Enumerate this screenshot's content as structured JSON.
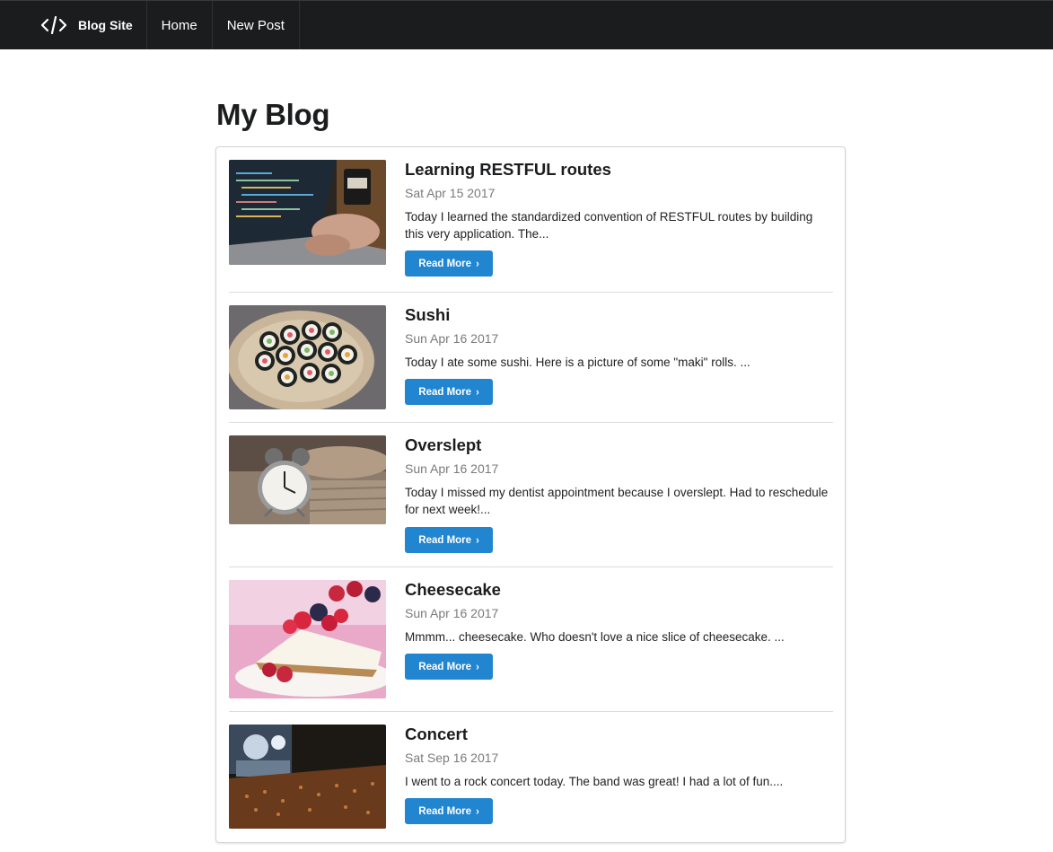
{
  "nav": {
    "brand_label": "Blog Site",
    "items": [
      {
        "label": "Home"
      },
      {
        "label": "New Post"
      }
    ]
  },
  "page": {
    "title": "My Blog"
  },
  "posts": [
    {
      "title": "Learning RESTFUL routes",
      "date": "Sat Apr 15 2017",
      "excerpt": "Today I learned the standardized convention of RESTFUL routes by building this very application. The...",
      "button_label": "Read More",
      "image": "laptop-coding-photo"
    },
    {
      "title": "Sushi",
      "date": "Sun Apr 16 2017",
      "excerpt": "Today I ate some sushi. Here is a picture of some \"maki\" rolls. ...",
      "button_label": "Read More",
      "image": "sushi-rolls-photo"
    },
    {
      "title": "Overslept",
      "date": "Sun Apr 16 2017",
      "excerpt": "Today I missed my dentist appointment because I overslept. Had to reschedule for next week!...",
      "button_label": "Read More",
      "image": "alarm-clock-photo"
    },
    {
      "title": "Cheesecake",
      "date": "Sun Apr 16 2017",
      "excerpt": "Mmmm... cheesecake. Who doesn't love a nice slice of cheesecake. ...",
      "button_label": "Read More",
      "image": "cheesecake-photo"
    },
    {
      "title": "Concert",
      "date": "Sat Sep 16 2017",
      "excerpt": "I went to a rock concert today. The band was great! I had a lot of fun....",
      "button_label": "Read More",
      "image": "concert-crowd-photo"
    }
  ],
  "colors": {
    "nav_background": "#1b1c1d",
    "button_primary": "#2185d0",
    "date_text": "#7a7a7a"
  },
  "icons": {
    "brand": "code-icon",
    "button": "chevron-right-icon"
  }
}
